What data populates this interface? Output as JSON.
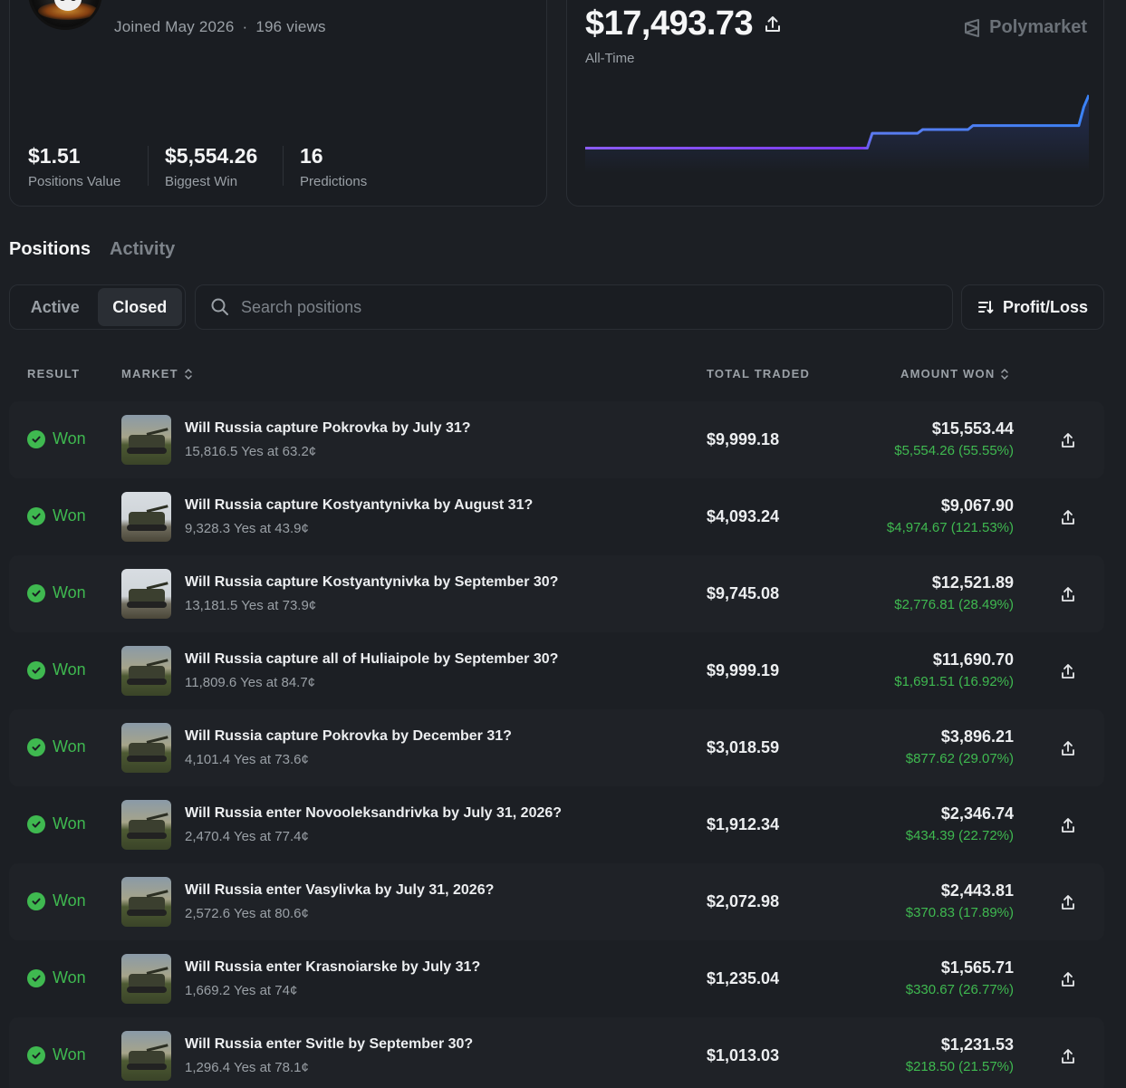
{
  "profile": {
    "joined": "Joined May 2026",
    "separator": "·",
    "views": "196 views",
    "stats": [
      {
        "value": "$1.51",
        "label": "Positions Value"
      },
      {
        "value": "$5,554.26",
        "label": "Biggest Win"
      },
      {
        "value": "16",
        "label": "Predictions"
      }
    ]
  },
  "pnl": {
    "amount": "$17,493.73",
    "period": "All-Time",
    "brand": "Polymarket"
  },
  "chart_data": {
    "type": "line",
    "x": [
      0,
      56,
      57,
      66,
      67,
      76,
      77,
      98,
      99,
      100
    ],
    "y": [
      1.5,
      1.5,
      6.0,
      6.0,
      7.1,
      7.1,
      8.3,
      8.3,
      13.9,
      17.5
    ],
    "colors": [
      "#7c3aed",
      "#3b82f6"
    ]
  },
  "tabs": [
    "Positions",
    "Activity"
  ],
  "filter": {
    "options": [
      "Active",
      "Closed"
    ],
    "selected": "Closed"
  },
  "search": {
    "placeholder": "Search positions"
  },
  "sort": {
    "label": "Profit/Loss"
  },
  "table": {
    "headers": {
      "result": "RESULT",
      "market": "MARKET",
      "total_traded": "TOTAL TRADED",
      "amount_won": "AMOUNT WON"
    },
    "rows": [
      {
        "result": "Won",
        "title": "Will Russia capture Pokrovka by July 31?",
        "sub": "15,816.5 Yes at 63.2¢",
        "traded": "$9,999.18",
        "won": "$15,553.44",
        "gain": "$5,554.26 (55.55%)"
      },
      {
        "result": "Won",
        "title": "Will Russia capture Kostyantynivka by August 31?",
        "sub": "9,328.3 Yes at 43.9¢",
        "traded": "$4,093.24",
        "won": "$9,067.90",
        "gain": "$4,974.67 (121.53%)"
      },
      {
        "result": "Won",
        "title": "Will Russia capture Kostyantynivka by September 30?",
        "sub": "13,181.5 Yes at 73.9¢",
        "traded": "$9,745.08",
        "won": "$12,521.89",
        "gain": "$2,776.81 (28.49%)"
      },
      {
        "result": "Won",
        "title": "Will Russia capture all of Huliaipole by September 30?",
        "sub": "11,809.6 Yes at 84.7¢",
        "traded": "$9,999.19",
        "won": "$11,690.70",
        "gain": "$1,691.51 (16.92%)"
      },
      {
        "result": "Won",
        "title": "Will Russia capture Pokrovka by December 31?",
        "sub": "4,101.4 Yes at 73.6¢",
        "traded": "$3,018.59",
        "won": "$3,896.21",
        "gain": "$877.62 (29.07%)"
      },
      {
        "result": "Won",
        "title": "Will Russia enter Novooleksandrivka by July 31, 2026?",
        "sub": "2,470.4 Yes at 77.4¢",
        "traded": "$1,912.34",
        "won": "$2,346.74",
        "gain": "$434.39 (22.72%)"
      },
      {
        "result": "Won",
        "title": "Will Russia enter Vasylivka by July 31, 2026?",
        "sub": "2,572.6 Yes at 80.6¢",
        "traded": "$2,072.98",
        "won": "$2,443.81",
        "gain": "$370.83 (17.89%)"
      },
      {
        "result": "Won",
        "title": "Will Russia enter Krasnoiarske by July 31?",
        "sub": "1,669.2 Yes at 74¢",
        "traded": "$1,235.04",
        "won": "$1,565.71",
        "gain": "$330.67 (26.77%)"
      },
      {
        "result": "Won",
        "title": "Will Russia enter Svitle by September 30?",
        "sub": "1,296.4 Yes at 78.1¢",
        "traded": "$1,013.03",
        "won": "$1,231.53",
        "gain": "$218.50 (21.57%)"
      }
    ]
  },
  "colors": {
    "positive": "#3fb950",
    "background": "#1c1f24",
    "card": "#1a1d22"
  }
}
